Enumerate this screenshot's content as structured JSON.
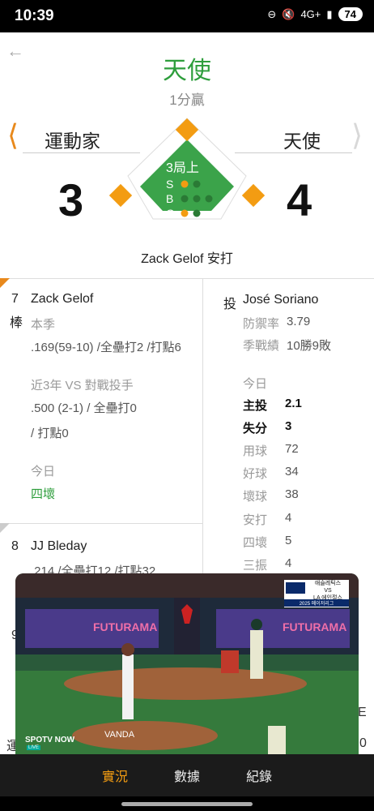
{
  "status": {
    "time": "10:39",
    "signal": "4G+",
    "battery": "74"
  },
  "header": {
    "winner": "天使",
    "margin": "1分贏"
  },
  "teams": {
    "away": "運動家",
    "home": "天使",
    "away_score": "3",
    "home_score": "4"
  },
  "inning": {
    "label": "3局上",
    "s": "S",
    "b": "B",
    "o": "O"
  },
  "play_text": "Zack Gelof 安打",
  "batter": {
    "order": "7",
    "order_suffix": "棒",
    "name": "Zack Gelof",
    "season_label": "本季",
    "season_stats": ".169(59-10) /全壘打2 /打點6",
    "vs_label": "近3年 VS 對戰投手",
    "vs_stats": ".500 (2-1) / 全壘打0",
    "vs_rbi": "/ 打點0",
    "today_label": "今日",
    "today_result": "四壞"
  },
  "next_batter": {
    "order": "8",
    "name": "JJ Bleday",
    "stats": ".214 /全壘打12 /打點32",
    "peek_order": "9"
  },
  "pitcher": {
    "role": "投",
    "name": "José Soriano",
    "era_label": "防禦率",
    "era": "3.79",
    "record_label": "季戰績",
    "record": "10勝9敗",
    "today_label": "今日",
    "rows": [
      {
        "label": "主投",
        "value": "2.1"
      },
      {
        "label": "失分",
        "value": "3"
      },
      {
        "label": "用球",
        "value": "72"
      },
      {
        "label": "好球",
        "value": "34"
      },
      {
        "label": "壞球",
        "value": "38"
      },
      {
        "label": "安打",
        "value": "4"
      },
      {
        "label": "四壞",
        "value": "5"
      },
      {
        "label": "三振",
        "value": "4"
      }
    ]
  },
  "video": {
    "banner": "FUTURAMA",
    "broadcaster": "SPOTV NOW",
    "live": "LIVE",
    "score_bug_line1": "애슬레틱스",
    "score_bug_vs": "VS",
    "score_bug_line2": "LA 에인절스",
    "score_bug_line3": "2025 메이저리그",
    "sponsor": "VANDA"
  },
  "peek": {
    "e": "E",
    "left_char": "運",
    "right_char": "0"
  },
  "nav": {
    "live": "實況",
    "stats": "數據",
    "record": "紀錄"
  }
}
